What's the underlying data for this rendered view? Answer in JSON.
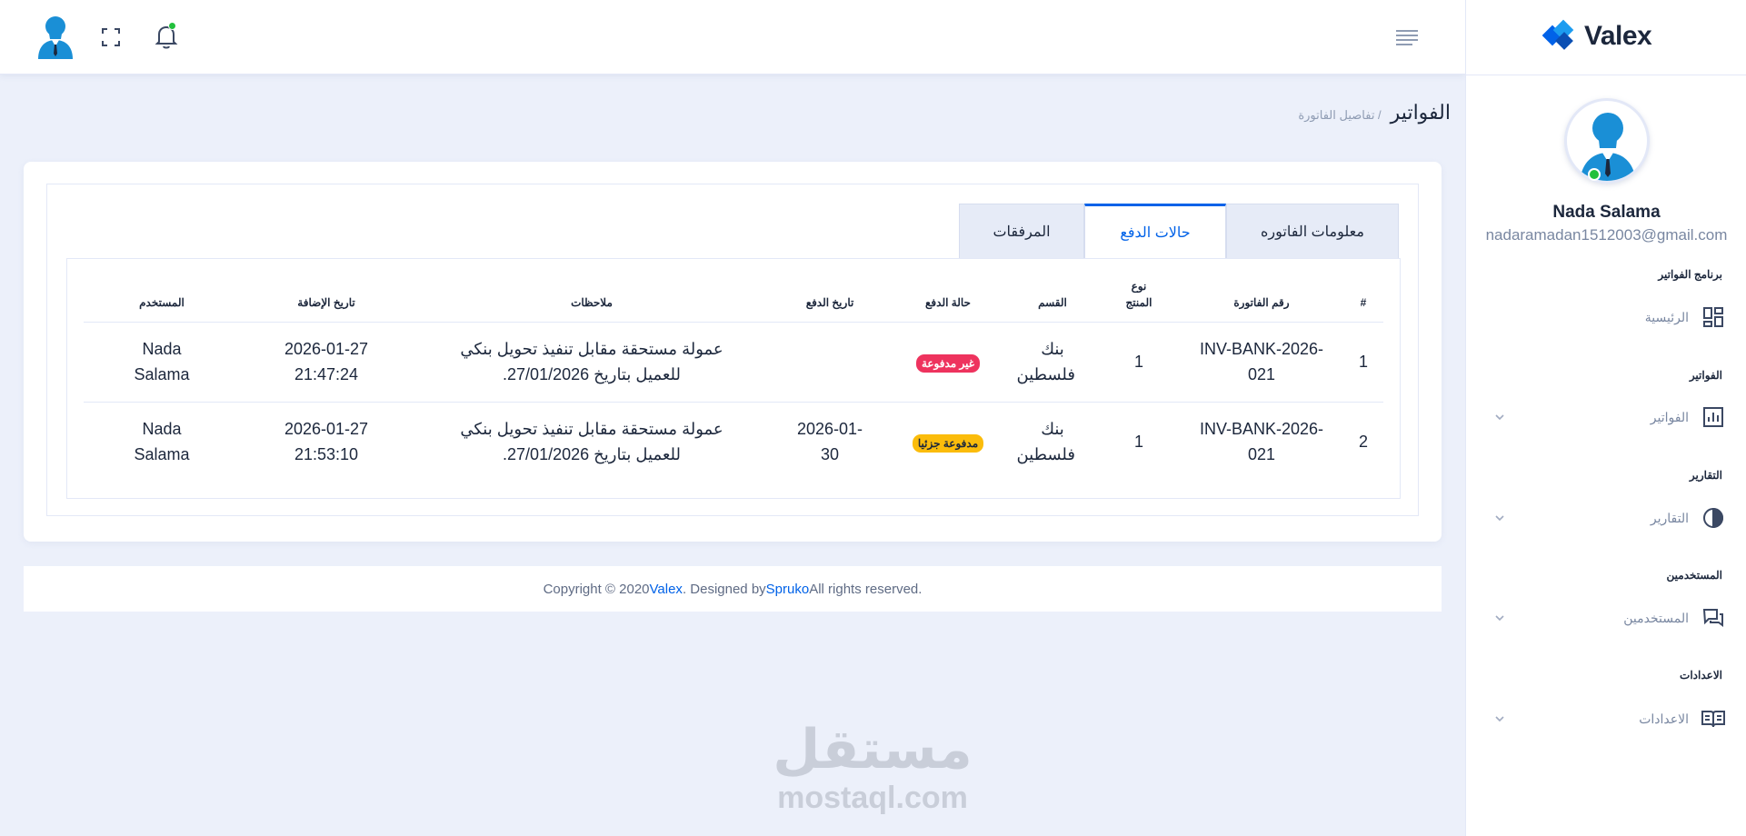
{
  "app": {
    "brand": "Valex"
  },
  "header": {},
  "sidebar": {
    "user_name": "Nada Salama",
    "user_email": "nadaramadan1512003@gmail.com",
    "sections": [
      {
        "category": "برنامج الفواتير",
        "label": "الرئيسية",
        "icon": "dashboard-icon",
        "has_chevron": false
      },
      {
        "category": "الفواتير",
        "label": "الفواتير",
        "icon": "bar-chart-icon",
        "has_chevron": true
      },
      {
        "category": "التقارير",
        "label": "التقارير",
        "icon": "pie-chart-icon",
        "has_chevron": true
      },
      {
        "category": "المستخدمين",
        "label": "المستخدمين",
        "icon": "chat-icon",
        "has_chevron": true
      },
      {
        "category": "الاعدادات",
        "label": "الاعدادات",
        "icon": "book-icon",
        "has_chevron": true
      }
    ]
  },
  "page": {
    "title": "الفواتير",
    "breadcrumb": "/ تفاصيل الفاتورة"
  },
  "tabs": [
    {
      "label": "معلومات الفاتوره",
      "active": false
    },
    {
      "label": "حالات الدفع",
      "active": true
    },
    {
      "label": "المرفقات",
      "active": false
    }
  ],
  "table": {
    "headers": {
      "num": "#",
      "invoice_number": "رقم الفاتورة",
      "product_type": "نوع المنتج",
      "section": "القسم",
      "payment_status": "حالة الدفع",
      "payment_date": "تاريخ الدفع",
      "notes": "ملاحظات",
      "added_date": "تاريخ الإضافة",
      "user": "المستخدم"
    },
    "rows": [
      {
        "num": "1",
        "invoice_number": "INV-BANK-2026-021",
        "product_type": "1",
        "section": "بنك فلسطين",
        "payment_status": "غير مدفوعة",
        "payment_date": "",
        "notes": "عمولة مستحقة مقابل تنفيذ تحويل بنكي للعميل بتاريخ 27/01/2026.",
        "added_date": "2026-01-27 21:47:24",
        "user": "Nada Salama"
      },
      {
        "num": "2",
        "invoice_number": "INV-BANK-2026-021",
        "product_type": "1",
        "section": "بنك فلسطين",
        "payment_status": "مدفوعة جزئيا",
        "payment_date": "2026-01-30",
        "notes": "عمولة مستحقة مقابل تنفيذ تحويل بنكي للعميل بتاريخ 27/01/2026.",
        "added_date": "2026-01-27 21:53:10",
        "user": "Nada Salama"
      }
    ]
  },
  "footer": {
    "prefix": "Copyright © 2020 ",
    "brand": "Valex",
    "middle": ". Designed by ",
    "designer": "Spruko",
    "suffix": " All rights reserved."
  },
  "watermark": {
    "arabic": "مستقل",
    "latin": "mostaql.com"
  },
  "colors": {
    "primary": "#0162e8",
    "danger": "#ee335e",
    "warning": "#fbbc0b",
    "online": "#22c03c",
    "background": "#ecf0fa"
  }
}
